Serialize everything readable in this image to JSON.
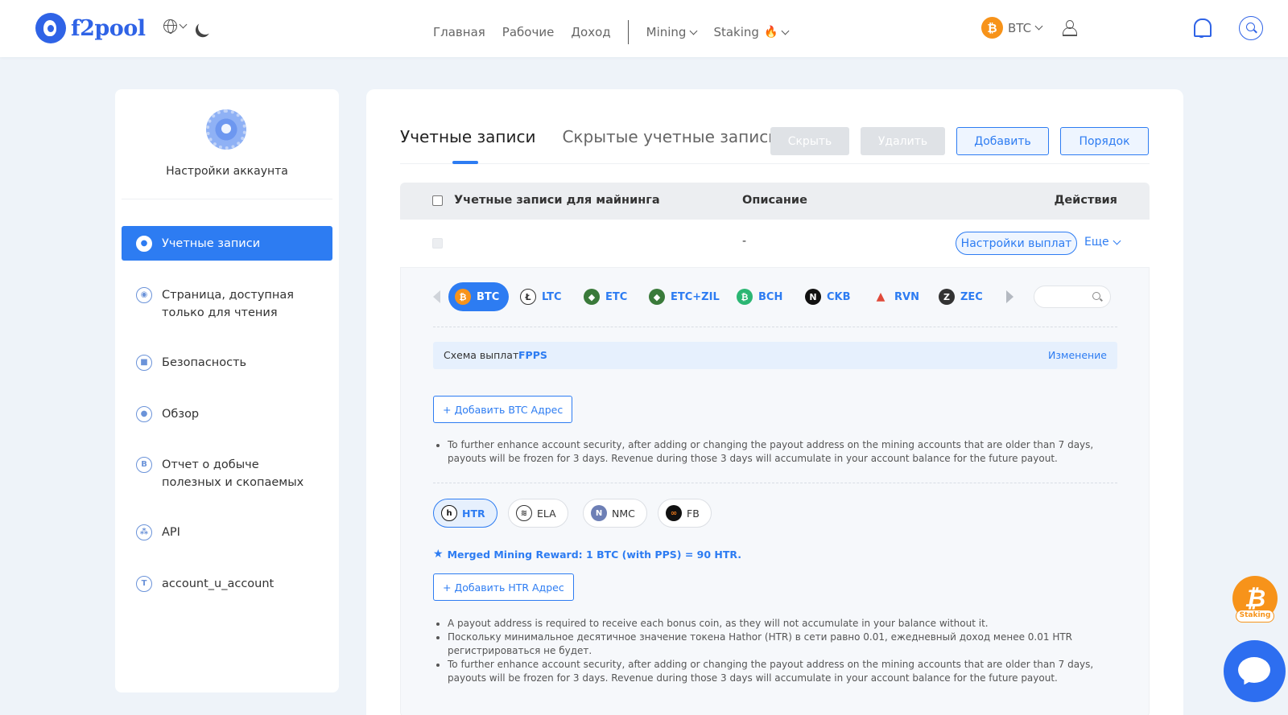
{
  "brand": {
    "name": "f2pool"
  },
  "nav": {
    "links": [
      "Главная",
      "Рабочие",
      "Доход"
    ],
    "mining": "Mining",
    "staking": "Staking",
    "coin": "BTC",
    "fire_icon": "🔥"
  },
  "sidebar": {
    "title": "Настройки аккаунта",
    "items": [
      {
        "label": "Учетные записи",
        "icon": "accounts-icon",
        "active": true
      },
      {
        "label": "Страница, доступная только для чтения",
        "icon": "eye-icon"
      },
      {
        "label": "Безопасность",
        "icon": "lock-icon"
      },
      {
        "label": "Обзор",
        "icon": "user-icon"
      },
      {
        "label": "Отчет о добыче полезных и скопаемых",
        "icon": "report-icon"
      },
      {
        "label": "API",
        "icon": "api-icon"
      },
      {
        "label": "account_u_account",
        "icon": "t-icon",
        "badge": "T"
      }
    ]
  },
  "main": {
    "tabs": [
      "Учетные записи",
      "Скрытые учетные записи"
    ],
    "buttons": {
      "hide": "Скрыть",
      "delete": "Удалить",
      "add": "Добавить",
      "order": "Порядок"
    },
    "table": {
      "col_accounts": "Учетные записи для майнинга",
      "col_description": "Описание",
      "col_actions": "Действия",
      "row": {
        "description": "-",
        "payout_settings": "Настройки выплат",
        "more": "Еще"
      }
    },
    "coins": [
      {
        "symbol": "BTC",
        "glyph": "₿",
        "color": "#f7931a",
        "active": true
      },
      {
        "symbol": "LTC",
        "glyph": "Ł",
        "color": "#ffffff"
      },
      {
        "symbol": "ETC",
        "glyph": "◆",
        "color": "#3a7a3a"
      },
      {
        "symbol": "ETC+ZIL",
        "glyph": "◆",
        "color": "#3a7a3a"
      },
      {
        "symbol": "BCH",
        "glyph": "₿",
        "color": "#2bb673"
      },
      {
        "symbol": "CKB",
        "glyph": "N",
        "color": "#111111"
      },
      {
        "symbol": "RVN",
        "glyph": "▲",
        "color": "#e04a3a"
      },
      {
        "symbol": "ZEC",
        "glyph": "Z",
        "color": "#333333"
      }
    ],
    "scheme": {
      "label": "Схема выплат",
      "value": "FPPS",
      "change": "Изменение"
    },
    "add_btc": "+ Добавить BTC Адрес",
    "note_btc": "To further enhance account security, after adding or changing the payout address on the mining accounts that are older than 7 days, payouts will be frozen for 3 days. Revenue during those 3 days will accumulate in your account balance for the future payout.",
    "merged": [
      {
        "symbol": "HTR",
        "glyph": "h",
        "color": "#111111",
        "active": true
      },
      {
        "symbol": "ELA",
        "glyph": "≋",
        "color": "#ffffff"
      },
      {
        "symbol": "NMC",
        "glyph": "N",
        "color": "#6d7fb5"
      },
      {
        "symbol": "FB",
        "glyph": "∞",
        "color": "#111111"
      }
    ],
    "reward": "Merged Mining Reward: 1 BTC (with PPS) = 90 HTR.",
    "add_htr": "+ Добавить HTR Адрес",
    "notes_htr": [
      "A payout address is required to receive each bonus coin, as they will not accumulate in your balance without it.",
      "Поскольку минимальное десятичное значение токена Hathor (HTR) в сети равно 0.01, ежедневный доход менее 0.01 HTR регистрироваться не будет.",
      "To further enhance account security, after adding or changing the payout address on the mining accounts that are older than 7 days, payouts will be frozen for 3 days. Revenue during those 3 days will accumulate in your account balance for the future payout."
    ]
  },
  "floating": {
    "staking_label": "Staking",
    "staking_glyph": "₿"
  }
}
